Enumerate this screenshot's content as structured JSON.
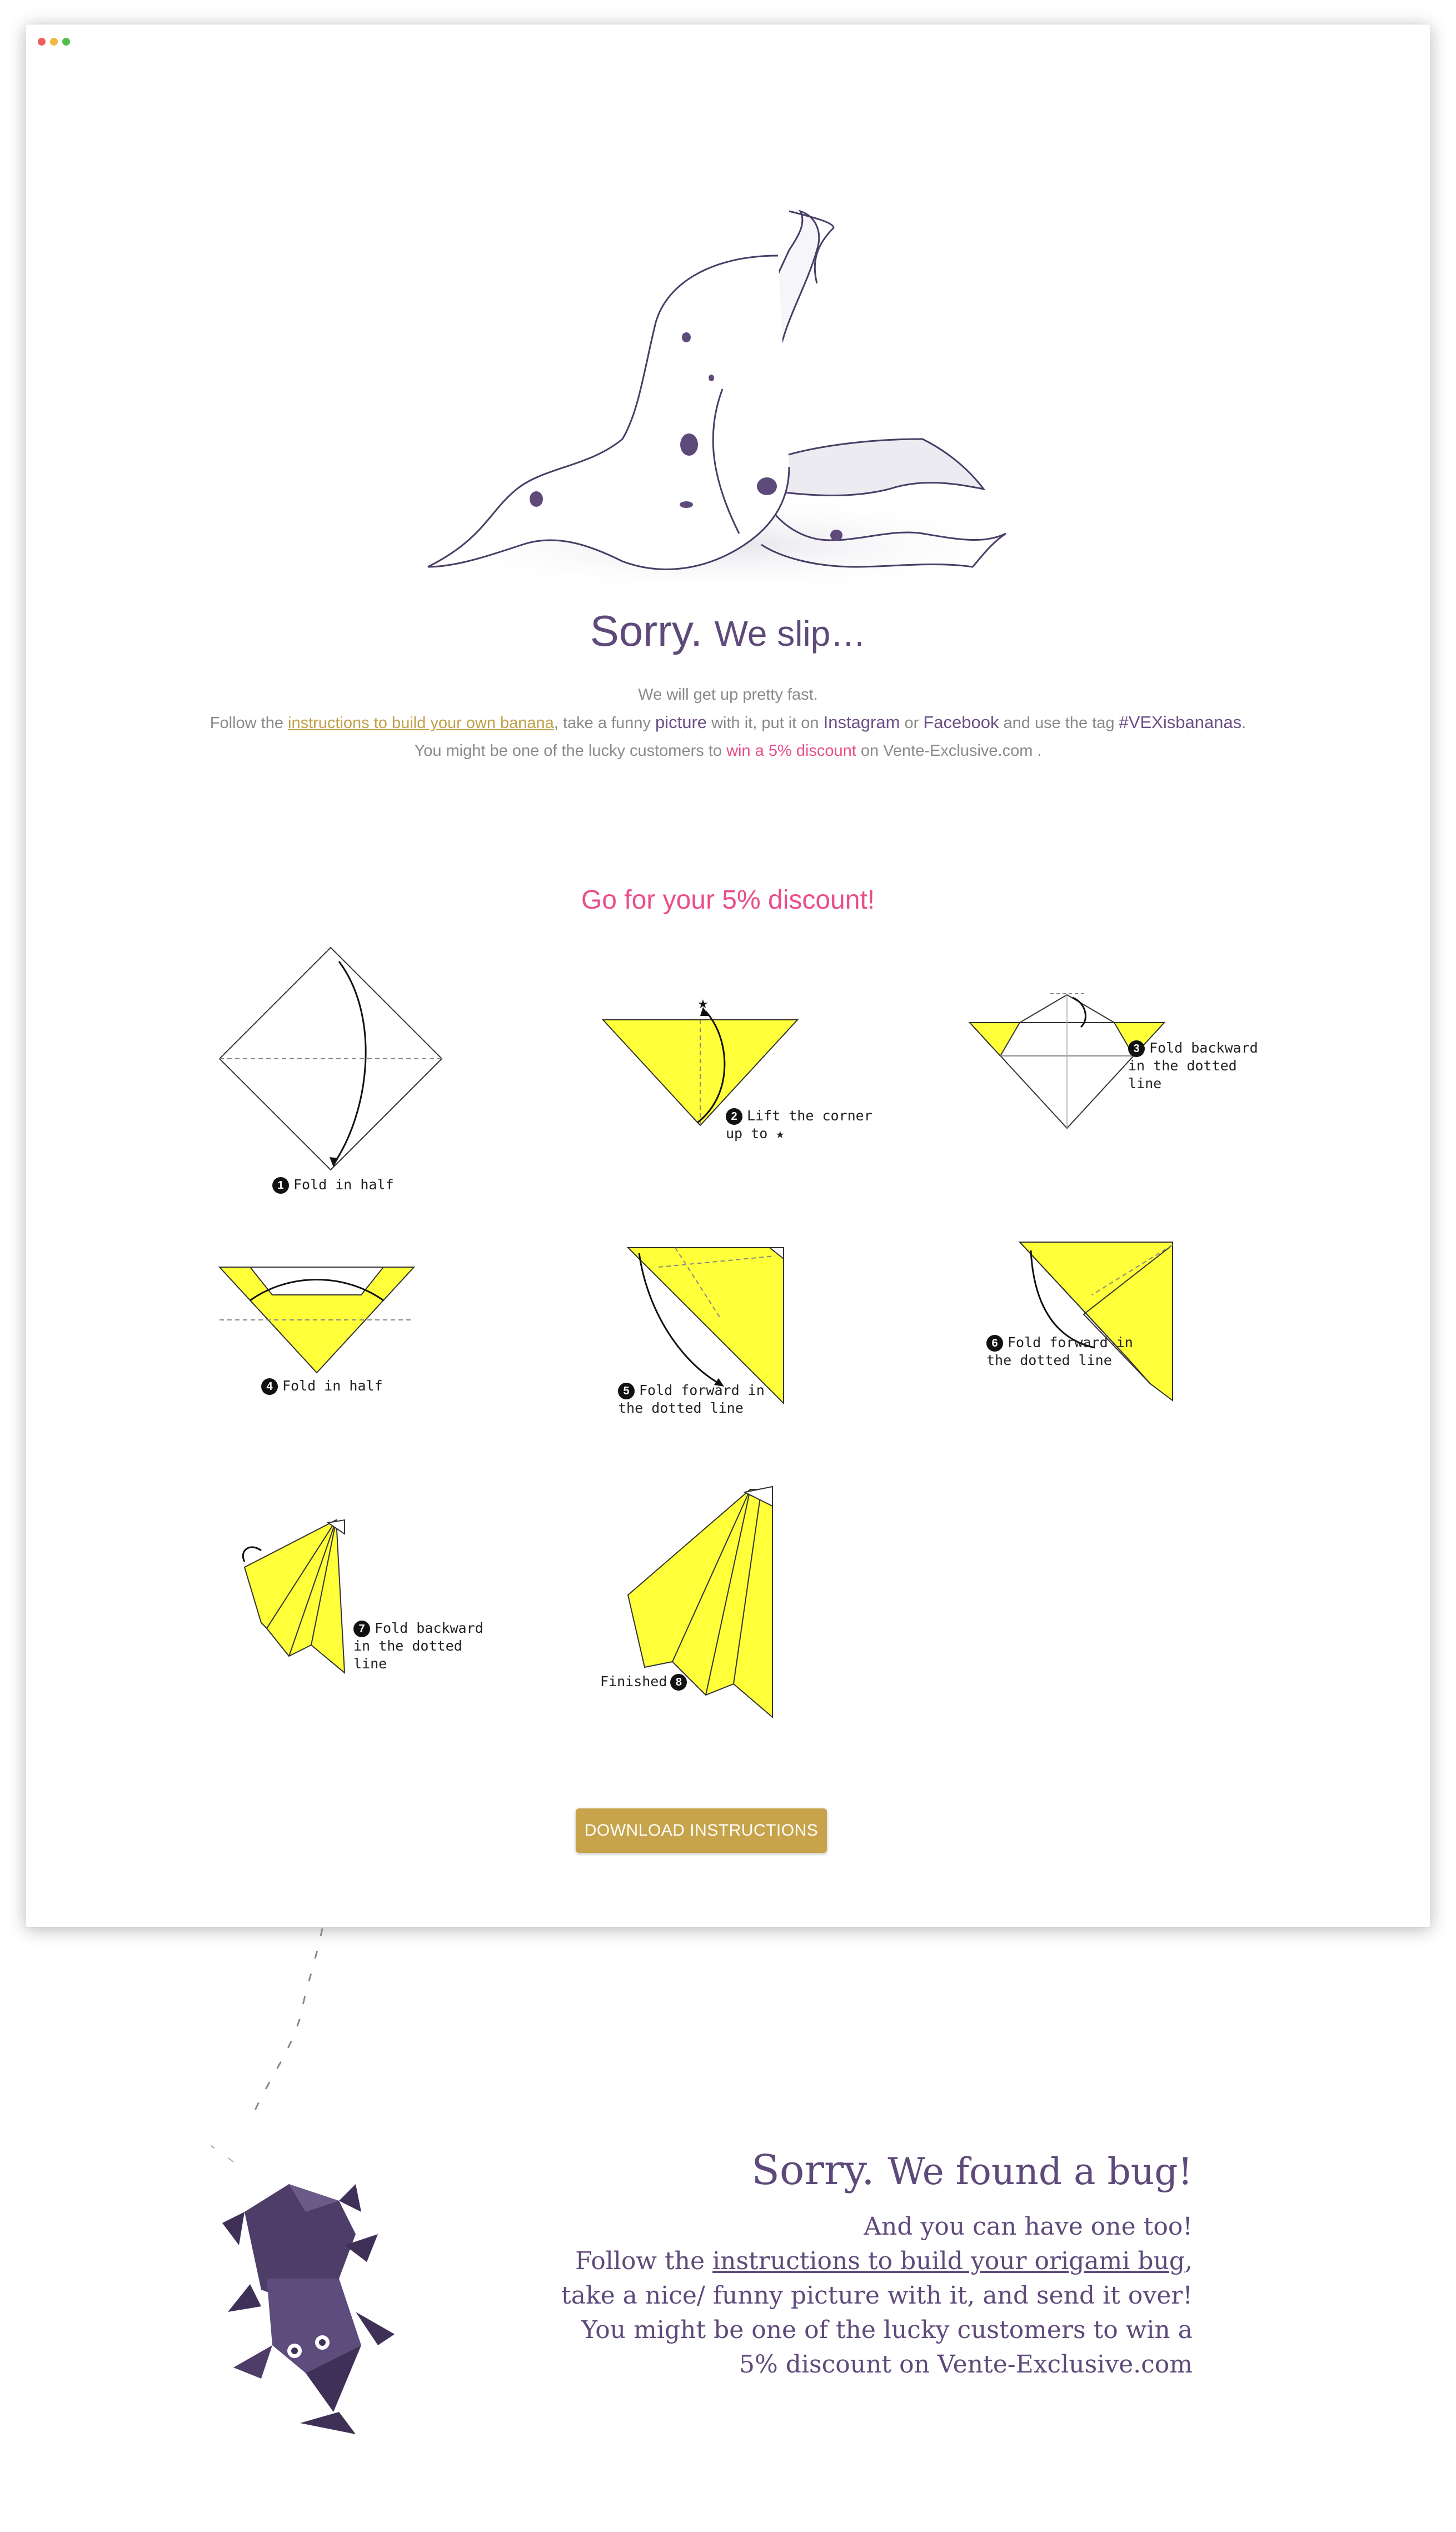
{
  "hero": {
    "title_main": "Sorry.",
    "title_sub": "We slip…"
  },
  "intro": {
    "line1": "We will get up pretty fast.",
    "line2_pre": "Follow the ",
    "line2_link": "instructions to build your own banana",
    "line2_mid1": ", take a funny ",
    "line2_picture": "picture",
    "line2_mid2": " with it, put it on ",
    "line2_instagram": "Instagram",
    "line2_or": " or ",
    "line2_facebook": "Facebook",
    "line2_mid3": " and use the tag ",
    "line2_tag": "#VEXisbananas",
    "line2_end": ".",
    "line3_pre": "You might be one of the lucky customers to ",
    "line3_link": "win a 5% discount",
    "line3_post": " on Vente-Exclusive.com ."
  },
  "discount_heading": "Go for your 5% discount!",
  "steps": [
    {
      "num": "1",
      "text": "Fold in half"
    },
    {
      "num": "2",
      "text": "Lift the corner\nup to ★"
    },
    {
      "num": "3",
      "text": "Fold backward\nin the dotted\nline"
    },
    {
      "num": "4",
      "text": "Fold in half"
    },
    {
      "num": "5",
      "text": "Fold forward in\nthe dotted line"
    },
    {
      "num": "6",
      "text": "Fold forward in\nthe dotted line"
    },
    {
      "num": "7",
      "text": "Fold backward\nin the dotted\nline"
    },
    {
      "num": "8",
      "text": "Finished"
    }
  ],
  "download_button": "DOWNLOAD INSTRUCTIONS",
  "bug": {
    "title_main": "Sorry.",
    "title_sub": "We found a bug!",
    "line1": "And you can have one too!",
    "line2_pre": "Follow the ",
    "line2_link": "instructions to build your origami bug",
    "line2_post": ",",
    "line3": "take a nice/ funny picture with it, and send it over!",
    "line4": "You might be one of the lucky customers to win a",
    "line5": "5% discount on Vente-Exclusive.com"
  },
  "colors": {
    "purple": "#5e4a7a",
    "pink": "#e94e8a",
    "gold": "#c7a44b",
    "yellow": "#ffff3a"
  }
}
